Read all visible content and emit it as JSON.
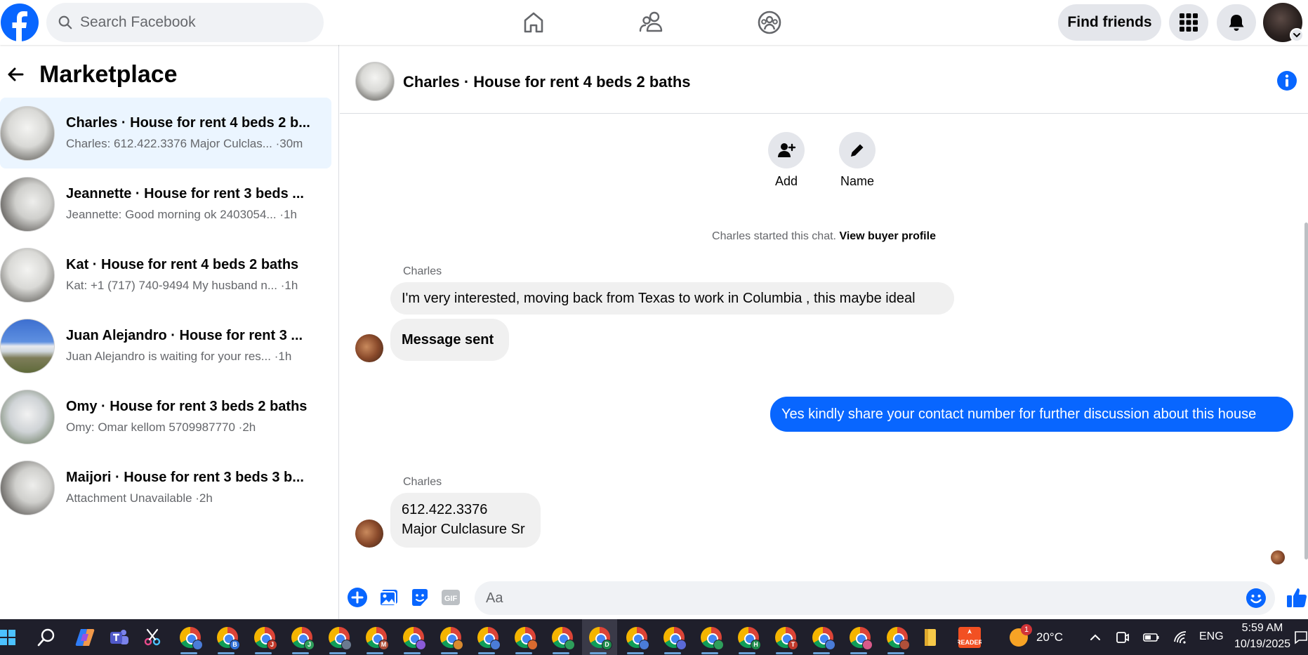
{
  "top_bar": {
    "search_placeholder": "Search Facebook",
    "find_friends_label": "Find friends",
    "nav_icons": [
      "home-icon",
      "friends-icon",
      "groups-icon"
    ],
    "brand_color": "#0866ff"
  },
  "sidebar": {
    "title": "Marketplace",
    "conversations": [
      {
        "title": "Charles · House for rent 4 beds 2 b...",
        "preview": "Charles: 612.422.3376 Major Culclas... ·30m",
        "active": true
      },
      {
        "title": "Jeannette · House for rent 3 beds ...",
        "preview": "Jeannette: Good morning ok 2403054... ·1h"
      },
      {
        "title": "Kat · House for rent 4 beds 2 baths",
        "preview": "Kat: +1 (717) 740-9494 My husband n... ·1h"
      },
      {
        "title": "Juan Alejandro · House for rent 3 ...",
        "preview": "Juan Alejandro is waiting for your res...  ·1h"
      },
      {
        "title": "Omy · House for rent 3 beds 2 baths",
        "preview": "Omy: Omar kellom 5709987770 ·2h"
      },
      {
        "title": "Maijori · House for rent 3 beds 3 b...",
        "preview": "Attachment Unavailable ·2h"
      }
    ]
  },
  "chat": {
    "header_title": "Charles · House for rent 4 beds 2 baths",
    "actions": {
      "add_label": "Add",
      "name_label": "Name"
    },
    "system_text": "Charles started this chat.",
    "system_link": "View buyer profile",
    "messages": {
      "sender_1": "Charles",
      "msg_1": "I'm very interested, moving back from Texas to work in Columbia , this maybe ideal",
      "msg_2": "Message sent",
      "msg_out": "Yes kindly share your contact number for further discussion about this house",
      "sender_2": "Charles",
      "msg_3_line1": "612.422.3376",
      "msg_3_line2": "Major Culclasure Sr"
    },
    "composer_placeholder": "Aa"
  },
  "taskbar": {
    "chrome_profiles": [
      "",
      "B",
      "J",
      "J",
      "",
      "M",
      "",
      "",
      "",
      "",
      "",
      "D",
      "",
      "",
      "",
      "H",
      "T",
      "",
      "",
      ""
    ],
    "weather": "20°C",
    "weather_badge": "1",
    "language": "ENG",
    "time": "5:59 AM",
    "date": "10/19/2025"
  }
}
